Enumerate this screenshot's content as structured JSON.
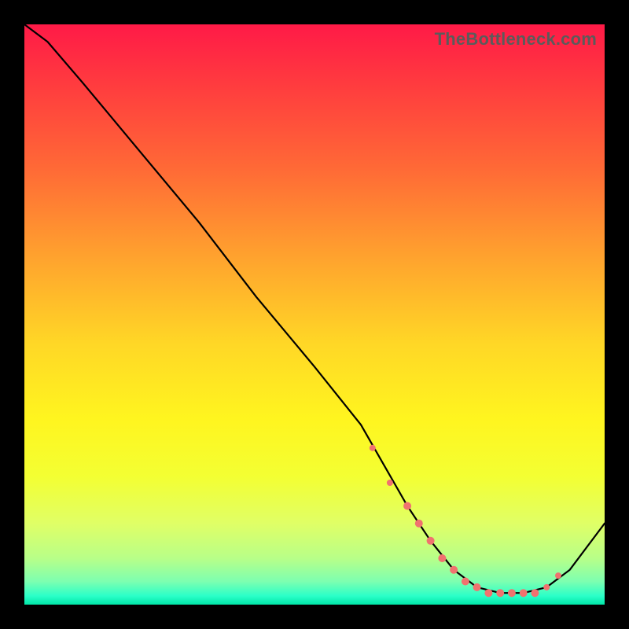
{
  "watermark": "TheBottleneck.com",
  "colors": {
    "background": "#000000",
    "curve": "#000000",
    "marker": "#f0726f",
    "gradient_stops": [
      "#ff1a47",
      "#ff3a3f",
      "#ff6a36",
      "#ffa22e",
      "#ffd726",
      "#fff51f",
      "#f3ff33",
      "#e0ff66",
      "#b8ff88",
      "#7dffb0",
      "#2bffc8",
      "#00e6a8"
    ]
  },
  "chart_data": {
    "type": "line",
    "title": "",
    "xlabel": "",
    "ylabel": "",
    "xlim": [
      0,
      100
    ],
    "ylim": [
      0,
      100
    ],
    "grid": false,
    "legend": false,
    "series": [
      {
        "name": "curve",
        "x": [
          0,
          4,
          10,
          20,
          30,
          40,
          50,
          58,
          62,
          66,
          70,
          74,
          78,
          82,
          86,
          90,
          94,
          100
        ],
        "y": [
          100,
          97,
          90,
          78,
          66,
          53,
          41,
          31,
          24,
          17,
          11,
          6,
          3,
          2,
          2,
          3,
          6,
          14
        ]
      }
    ],
    "markers": {
      "name": "highlighted-points",
      "x": [
        60,
        63,
        66,
        68,
        70,
        72,
        74,
        76,
        78,
        80,
        82,
        84,
        86,
        88,
        90,
        92
      ],
      "y": [
        27,
        21,
        17,
        14,
        11,
        8,
        6,
        4,
        3,
        2,
        2,
        2,
        2,
        2,
        3,
        5
      ],
      "r": [
        4,
        4,
        5,
        5,
        5,
        5,
        5,
        5,
        5,
        5,
        5,
        5,
        5,
        5,
        4,
        4
      ]
    }
  }
}
